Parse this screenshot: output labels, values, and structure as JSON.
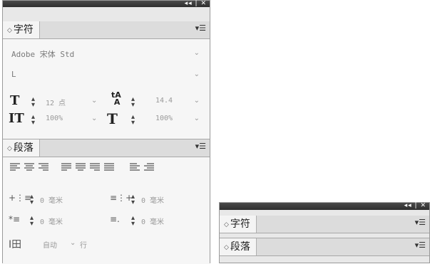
{
  "panel_main": {
    "controls": "◂◂ | ✕",
    "character": {
      "tab_label": "字符",
      "font_family": "Adobe 宋体 Std",
      "font_style": "L",
      "font_size": "12 点",
      "leading": "14.4",
      "vertical_scale": "100%",
      "horizontal_scale": "100%"
    },
    "paragraph": {
      "tab_label": "段落",
      "left_indent": "0 毫米",
      "right_indent": "0 毫米",
      "first_line_indent": "0 毫米",
      "last_line_indent": "0 毫米",
      "auto": "自动",
      "rows": "行"
    }
  },
  "panel_collapsed": {
    "controls": "◂◂ | ✕",
    "character_tab": "字符",
    "paragraph_tab": "段落"
  }
}
